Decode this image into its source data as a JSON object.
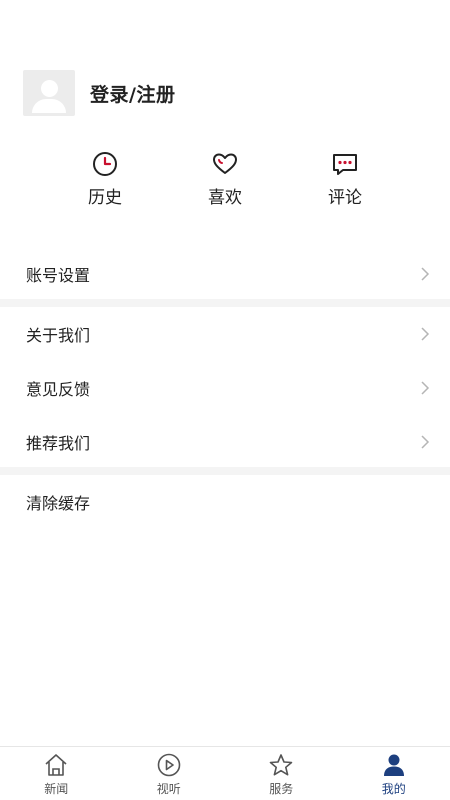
{
  "profile": {
    "login_label": "登录/注册"
  },
  "quick_actions": [
    {
      "label": "历史",
      "icon": "clock-icon"
    },
    {
      "label": "喜欢",
      "icon": "heart-icon"
    },
    {
      "label": "评论",
      "icon": "comment-icon"
    }
  ],
  "menu": {
    "account_settings": "账号设置",
    "about_us": "关于我们",
    "feedback": "意见反馈",
    "recommend_us": "推荐我们",
    "clear_cache": "清除缓存"
  },
  "tabs": [
    {
      "label": "新闻",
      "icon": "home-icon"
    },
    {
      "label": "视听",
      "icon": "play-icon"
    },
    {
      "label": "服务",
      "icon": "star-icon"
    },
    {
      "label": "我的",
      "icon": "user-icon",
      "active": true
    }
  ],
  "colors": {
    "accent_red": "#c8102e",
    "accent_blue": "#1d3f7f",
    "chevron": "#b5b5b5"
  }
}
